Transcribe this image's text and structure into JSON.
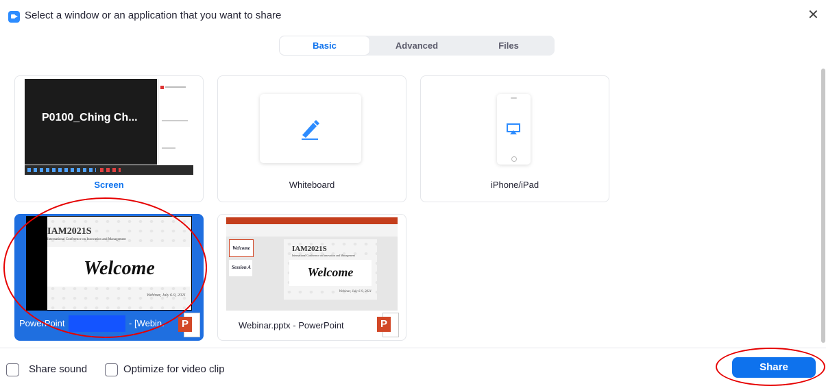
{
  "window": {
    "title": "Select a window or an application that you want to share",
    "close_glyph": "✕"
  },
  "tabs": [
    {
      "label": "Basic",
      "active": true
    },
    {
      "label": "Advanced",
      "active": false
    },
    {
      "label": "Files",
      "active": false
    }
  ],
  "sources": {
    "screen": {
      "label": "Screen",
      "thumb_text": "P0100_Ching  Ch..."
    },
    "whiteboard": {
      "label": "Whiteboard",
      "icon": "pen-icon"
    },
    "iphone": {
      "label": "iPhone/iPad",
      "icon": "airplay-icon"
    },
    "ppt_window": {
      "label_prefix": "PowerPoint",
      "label_suffix": "- [Webin.",
      "slide_title": "IAM2021S",
      "slide_subtitle": "International Conference on Innovation and Management",
      "slide_welcome": "Welcome",
      "slide_date": "Webinar, July 6-9, 2021",
      "selected": true
    },
    "webinar_pptx": {
      "label": "Webinar.pptx - PowerPoint",
      "slide_title": "IAM2021S",
      "slide_subtitle": "International Conference on Innovation and Management",
      "slide_welcome": "Welcome",
      "slide_date": "Webinar, July 6-9, 2021",
      "side_welcome": "Welcome",
      "side_session": "Session A"
    }
  },
  "footer": {
    "share_sound": "Share sound",
    "optimize_video": "Optimize for video clip",
    "share_button": "Share"
  },
  "colors": {
    "accent": "#0e72ed",
    "annotation": "#e60000",
    "selected_bg": "#1f6fe0"
  }
}
